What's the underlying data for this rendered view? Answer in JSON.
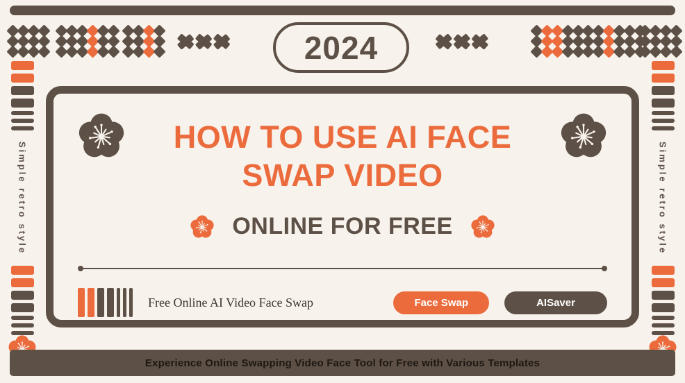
{
  "theme": {
    "background": "#f7f2ec",
    "brown": "#5d5046",
    "orange": "#ec6b3c",
    "dark_text": "#1d1713"
  },
  "header": {
    "year_badge": "2024"
  },
  "ornaments": {
    "diamond_groups": [
      {
        "rows": 3,
        "cols": 4,
        "orange_cols": []
      },
      {
        "rows": 3,
        "cols": 6,
        "orange_cols": [
          3
        ]
      },
      {
        "rows": 3,
        "cols": 4,
        "orange_cols": [
          2
        ]
      },
      {
        "rows": 3,
        "cols": 5,
        "orange_cols": [
          1,
          2
        ]
      },
      {
        "rows": 3,
        "cols": 6,
        "orange_cols": [
          2
        ]
      },
      {
        "rows": 3,
        "cols": 4,
        "orange_cols": []
      }
    ],
    "chevrons_right_count": 3,
    "chevrons_left_count": 3
  },
  "side_rails": {
    "label": "Simple retro style",
    "bar_stack": [
      {
        "weight": "thick",
        "color": "orange"
      },
      {
        "weight": "thick",
        "color": "orange"
      },
      {
        "weight": "thick",
        "color": "brown"
      },
      {
        "weight": "thick",
        "color": "brown"
      },
      {
        "weight": "thin",
        "color": "brown"
      },
      {
        "weight": "thin",
        "color": "brown"
      },
      {
        "weight": "thin",
        "color": "brown"
      }
    ]
  },
  "card": {
    "title_line_1": "HOW TO USE AI FACE",
    "title_line_2": "SWAP VIDEO",
    "subtitle": "ONLINE FOR FREE",
    "tagline": "Free Online AI Video Face Swap",
    "barcode": [
      {
        "weight": "wide",
        "color": "orange"
      },
      {
        "weight": "wide",
        "color": "orange"
      },
      {
        "weight": "wide",
        "color": "brown"
      },
      {
        "weight": "wide",
        "color": "brown"
      },
      {
        "weight": "narrow",
        "color": "brown"
      },
      {
        "weight": "narrow",
        "color": "brown"
      },
      {
        "weight": "narrow",
        "color": "brown"
      }
    ],
    "buttons": {
      "primary_label": "Face Swap",
      "secondary_label": "AISaver"
    }
  },
  "footer": {
    "banner_text": "Experience Online Swapping Video Face Tool for Free with Various Templates"
  }
}
